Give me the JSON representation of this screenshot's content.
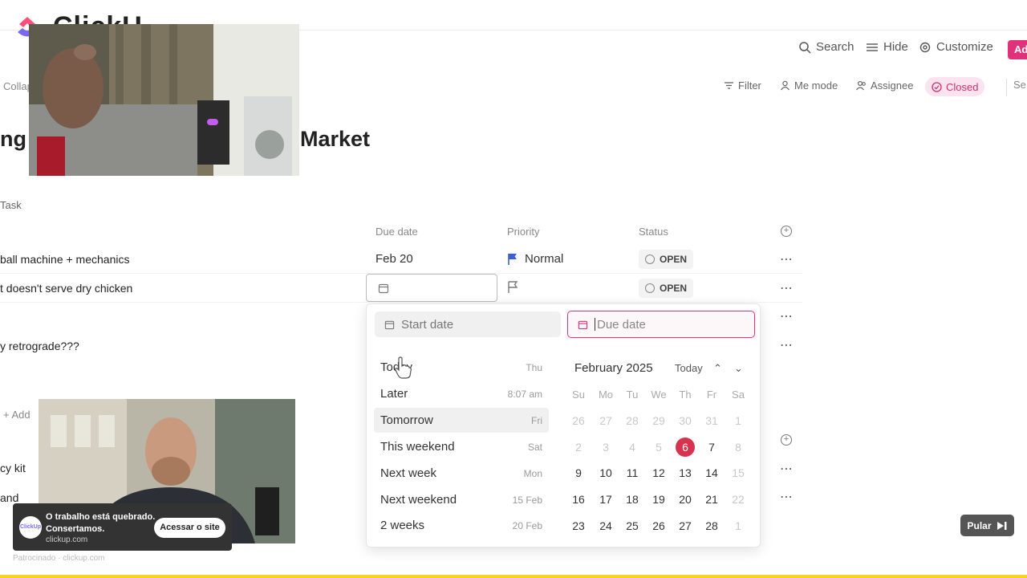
{
  "app": {
    "logo_text": "ClickU"
  },
  "toolbar": {
    "search": "Search",
    "hide": "Hide",
    "customize": "Customize",
    "add": "Ad"
  },
  "toolbar2": {
    "collapse": "Collap",
    "filter": "Filter",
    "me_mode": "Me mode",
    "assignee": "Assignee",
    "closed": "Closed",
    "se": "Se"
  },
  "page": {
    "title_left": "ng",
    "title_right": "Market"
  },
  "list": {
    "task_label": "Task",
    "columns": {
      "due": "Due date",
      "priority": "Priority",
      "status": "Status"
    },
    "rows": [
      {
        "name": "ball machine + mechanics",
        "due": "Feb 20",
        "priority": "Normal",
        "status": "OPEN"
      },
      {
        "name": "t doesn't serve dry chicken",
        "due": "",
        "priority": "",
        "status": "OPEN"
      },
      {
        "name": "",
        "status": ""
      },
      {
        "name": "y retrograde???",
        "status": ""
      }
    ],
    "add_task": "Add",
    "rows2": [
      "cy kit",
      "and"
    ]
  },
  "datepicker": {
    "start_placeholder": "Start date",
    "due_placeholder": "Due date",
    "shortcuts": [
      {
        "label": "Today",
        "hint": "Thu"
      },
      {
        "label": "Later",
        "hint": "8:07 am"
      },
      {
        "label": "Tomorrow",
        "hint": "Fri"
      },
      {
        "label": "This weekend",
        "hint": "Sat"
      },
      {
        "label": "Next week",
        "hint": "Mon"
      },
      {
        "label": "Next weekend",
        "hint": "15 Feb"
      },
      {
        "label": "2 weeks",
        "hint": "20 Feb"
      }
    ],
    "month": "February 2025",
    "today_label": "Today",
    "dow": [
      "Su",
      "Mo",
      "Tu",
      "We",
      "Th",
      "Fr",
      "Sa"
    ],
    "weeks": [
      [
        "26",
        "27",
        "28",
        "29",
        "30",
        "31",
        "1"
      ],
      [
        "2",
        "3",
        "4",
        "5",
        "6",
        "7",
        "8"
      ],
      [
        "9",
        "10",
        "11",
        "12",
        "13",
        "14",
        "15"
      ],
      [
        "16",
        "17",
        "18",
        "19",
        "20",
        "21",
        "22"
      ],
      [
        "23",
        "24",
        "25",
        "26",
        "27",
        "28",
        "1"
      ]
    ],
    "selected_day": "6"
  },
  "ad": {
    "line1": "O trabalho está quebrado.",
    "line2": "Consertamos.",
    "domain": "clickup.com",
    "button": "Acessar o site",
    "logo": "ClickUp",
    "sponsored": "Patrocinado · clickup.com",
    "skip": "Pular"
  },
  "colors": {
    "accent": "#e0317b",
    "today": "#d6334f",
    "flag": "#3b5fd9"
  }
}
